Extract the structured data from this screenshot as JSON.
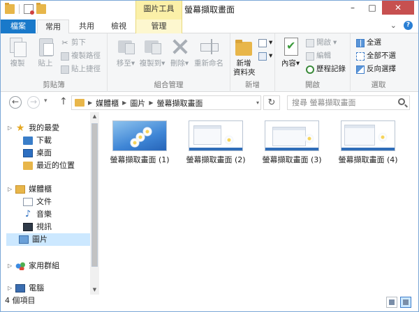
{
  "window": {
    "title": "螢幕擷取畫面",
    "context_tab_group": "圖片工具",
    "controls": {
      "minimize": "–",
      "maximize": "□",
      "close": "✕"
    }
  },
  "ribbon_tabs": {
    "file": "檔案",
    "home": "常用",
    "share": "共用",
    "view": "檢視",
    "manage": "管理",
    "collapse_icon": "chevron-down-icon",
    "help_icon": "help-icon",
    "help_symbol": "?"
  },
  "ribbon": {
    "clipboard": {
      "label": "剪貼簿",
      "copy": "複製",
      "paste": "貼上",
      "cut": "剪下",
      "copy_path": "複製路徑",
      "paste_shortcut": "貼上捷徑",
      "cut_symbol": "✂"
    },
    "organize": {
      "label": "組合管理",
      "move_to": "移至",
      "copy_to": "複製到",
      "delete": "刪除",
      "rename": "重新命名",
      "dropdown": "▾"
    },
    "new": {
      "label": "新增",
      "new_folder_line1": "新增",
      "new_folder_line2": "資料夾"
    },
    "open": {
      "label": "開啟",
      "properties": "內容",
      "open": "開啟",
      "edit": "編輯",
      "history": "歷程記錄",
      "dropdown": "▾"
    },
    "select": {
      "label": "選取",
      "select_all": "全選",
      "select_none": "全部不選",
      "invert": "反向選擇"
    }
  },
  "address_bar": {
    "back": "←",
    "forward": "→",
    "history_dropdown": "▾",
    "up": "↑",
    "breadcrumbs": [
      "媒體櫃",
      "圖片",
      "螢幕擷取畫面"
    ],
    "crumb_separator": "▶",
    "address_dropdown": "▾",
    "refresh": "↻",
    "search_placeholder": "搜尋 螢幕擷取畫面"
  },
  "nav_pane": {
    "favorites": {
      "header": "我的最愛",
      "items": [
        "下載",
        "桌面",
        "最近的位置"
      ]
    },
    "libraries": {
      "header": "媒體櫃",
      "items": [
        "文件",
        "音樂",
        "視訊",
        "圖片"
      ],
      "selected": "圖片"
    },
    "homegroup": "家用群組",
    "computer": "電腦",
    "expand_symbol": "▷",
    "star_symbol": "★",
    "music_symbol": "♪",
    "scroll_up": "▲",
    "scroll_down": "▼"
  },
  "files": [
    {
      "name": "螢幕擷取畫面 (1)",
      "thumb": "wallpaper"
    },
    {
      "name": "螢幕擷取畫面 (2)",
      "thumb": "window"
    },
    {
      "name": "螢幕擷取畫面 (3)",
      "thumb": "window"
    },
    {
      "name": "螢幕擷取畫面 (4)",
      "thumb": "window"
    }
  ],
  "status_bar": {
    "item_count": "4 個項目"
  },
  "colors": {
    "file_tab": "#1979ca",
    "context_tab": "#fbf0a8",
    "selection": "#cce8ff",
    "close_button": "#c75050"
  }
}
